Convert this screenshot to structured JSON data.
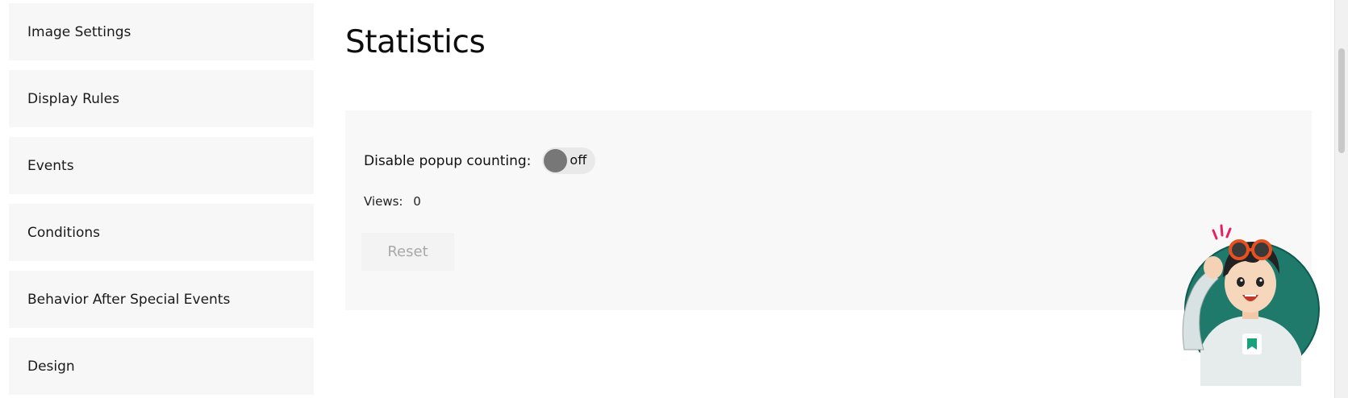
{
  "sidebar": {
    "items": [
      {
        "label": "Image Settings"
      },
      {
        "label": "Display Rules"
      },
      {
        "label": "Events"
      },
      {
        "label": "Conditions"
      },
      {
        "label": "Behavior After Special Events"
      },
      {
        "label": "Design"
      }
    ]
  },
  "main": {
    "title": "Statistics",
    "counting_label": "Disable popup counting:",
    "counting_toggle": {
      "state": "off"
    },
    "views_label": "Views:",
    "views_count": "0",
    "reset_label": "Reset"
  },
  "colors": {
    "panel_bg": "#f8f8f8",
    "sidebar_bg": "#f7f7f7",
    "toggle_knob": "#777777",
    "mascot_circle": "#1f7a6c",
    "mascot_hair": "#222222",
    "mascot_glasses": "#e8511f"
  },
  "icons": {
    "mascot": "support-mascot-avatar"
  }
}
